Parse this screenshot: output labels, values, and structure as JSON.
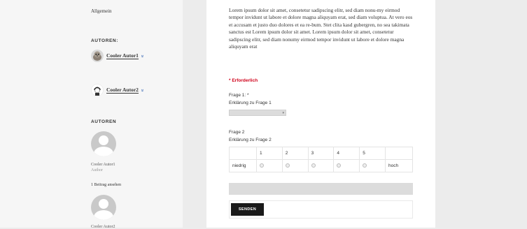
{
  "sidebar": {
    "category": "Allgemein",
    "authors_heading_1": "AUTOREN:",
    "authors": [
      {
        "name": "Cooler Autor1",
        "chevron": "»"
      },
      {
        "name": "Cooler Autor2",
        "chevron": "»"
      }
    ],
    "authors_heading_2": "AUTOREN",
    "author_cards": [
      {
        "name": "Cooler Autor1",
        "role": "Author",
        "posts_link": "1 Beitrag ansehen"
      },
      {
        "name": "Cooler Autor2"
      }
    ]
  },
  "main": {
    "paragraph": "Lorem ipsum dolor sit amet, consetetur sadipscing elitr, sed diam nonu-my eirmod tempor invidunt ut labore et dolore magna aliquyam erat, sed diam voluptua. At vero eos et accusam et justo duo dolores et ea re-bum. Stet clita kasd gubergren, no sea takimata sanctus est Lorem ipsum dolor sit amet. Lorem ipsum dolor sit amet, consetetur sadipscing elitr, sed diam nonumy eirmod tempor invidunt ut labore et dolore magna aliquyam erat",
    "required_note": "* Erforderlich",
    "question1": {
      "label": "Frage 1: *",
      "explanation": "Erklärung zu Frage 1",
      "select_arrow": "▾"
    },
    "question2": {
      "label": "Frage 2",
      "explanation": "Erklärung zu Frage 2",
      "scale": [
        "1",
        "2",
        "3",
        "4",
        "5"
      ],
      "low_label": "niedrig",
      "high_label": "hoch"
    },
    "submit_label": "SENDEN"
  }
}
